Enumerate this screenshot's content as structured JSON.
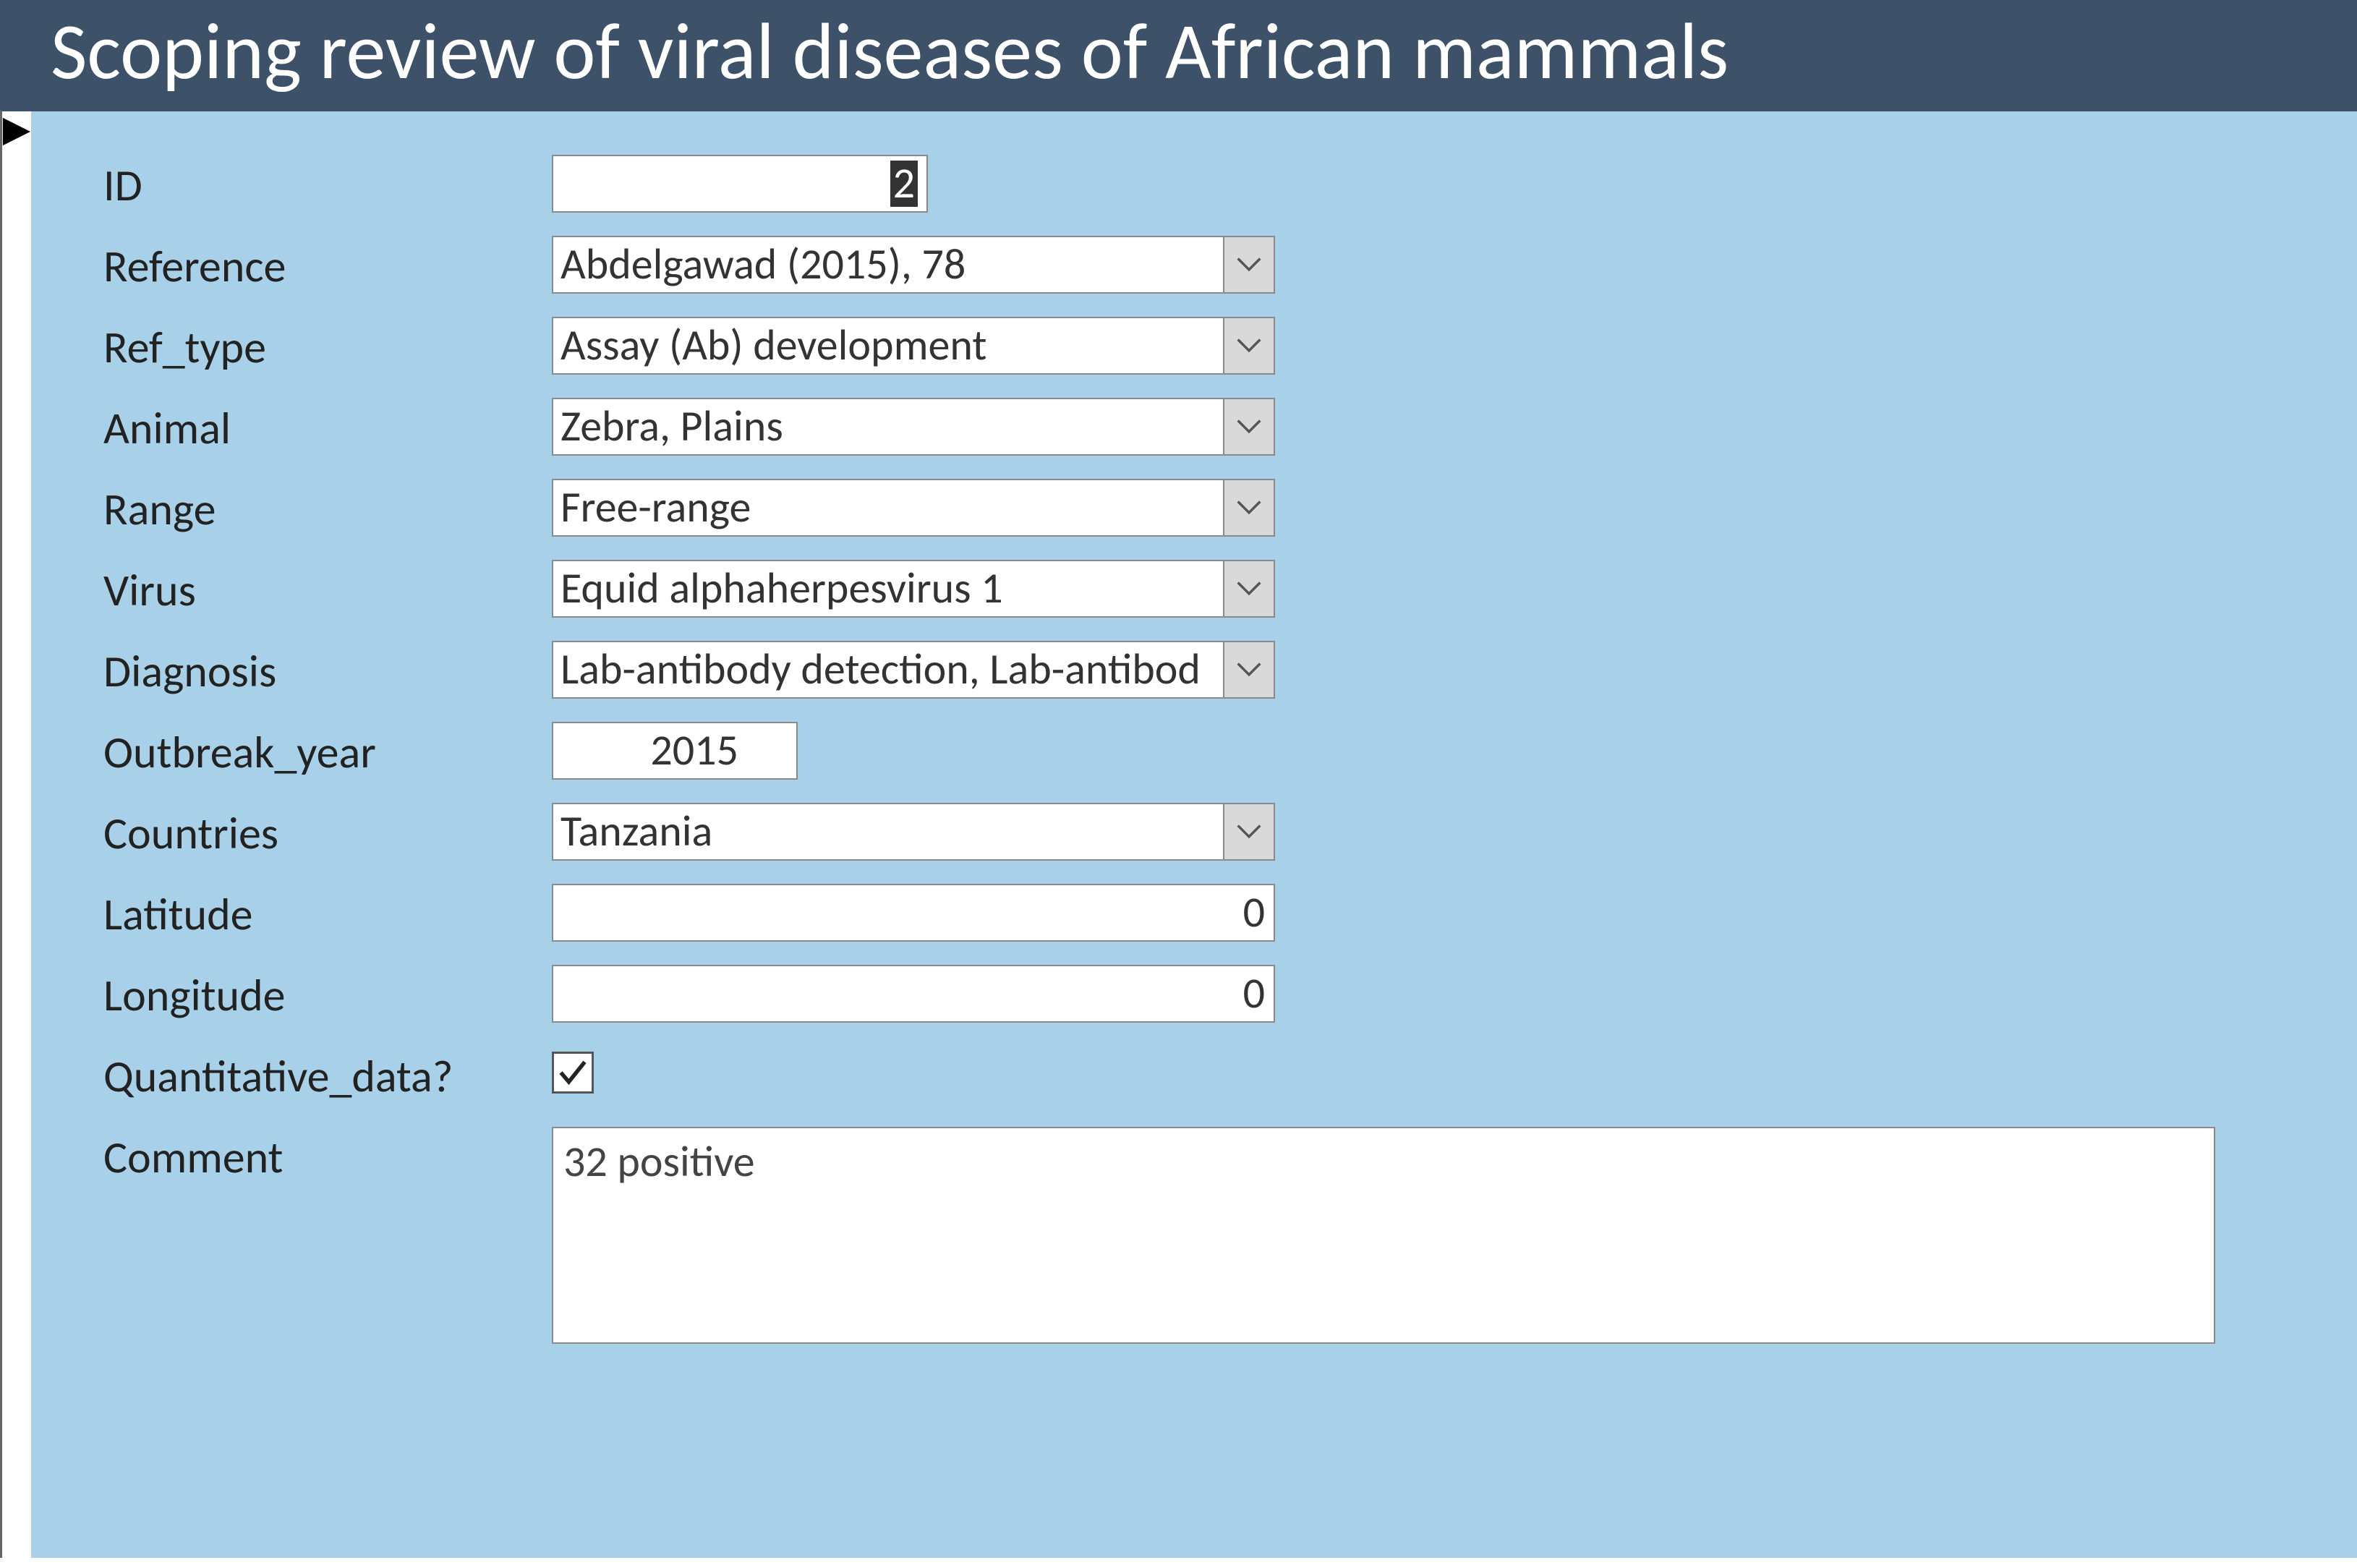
{
  "title": "Scoping review of viral diseases of African mammals",
  "record_marker": "▶",
  "labels": {
    "id": "ID",
    "reference": "Reference",
    "ref_type": "Ref_type",
    "animal": "Animal",
    "range": "Range",
    "virus": "Virus",
    "diagnosis": "Diagnosis",
    "outbreak_year": "Outbreak_year",
    "countries": "Countries",
    "latitude": "Latitude",
    "longitude": "Longitude",
    "quantitative_data": "Quantitative_data?",
    "comment": "Comment"
  },
  "values": {
    "id": "2",
    "reference": "Abdelgawad (2015), 78",
    "ref_type": "Assay (Ab) development",
    "animal": "Zebra, Plains",
    "range": "Free-range",
    "virus": "Equid alphaherpesvirus 1",
    "diagnosis": "Lab-antibody detection, Lab-antibod",
    "outbreak_year": "2015",
    "countries": "Tanzania",
    "latitude": "0",
    "longitude": "0",
    "quantitative_data_checked": true,
    "comment": "32 positive"
  }
}
